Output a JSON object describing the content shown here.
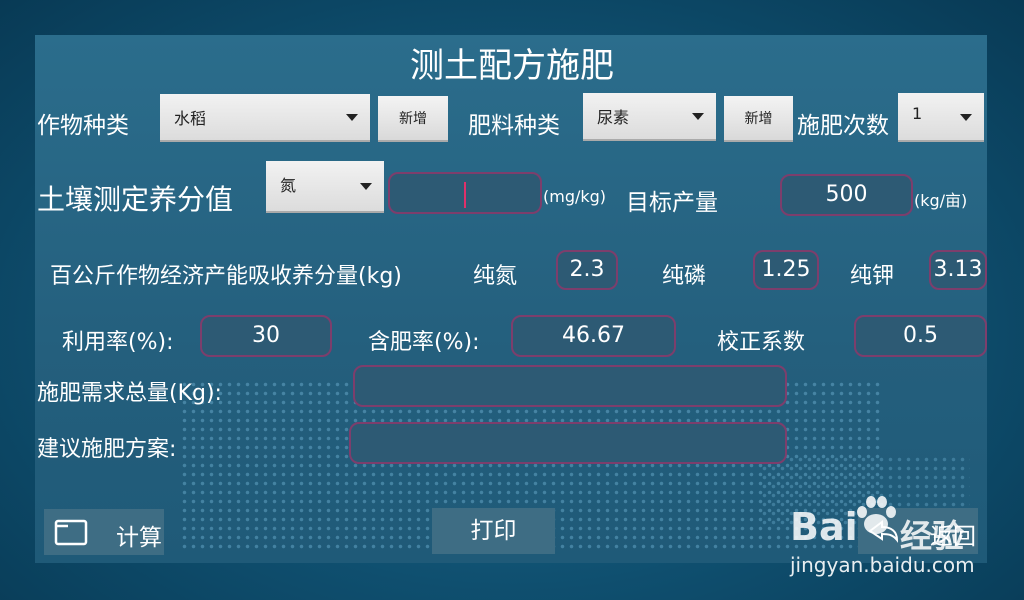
{
  "title": "测土配方施肥",
  "row1": {
    "crop_label": "作物种类",
    "crop_value": "水稻",
    "add1": "新增",
    "fert_label": "肥料种类",
    "fert_value": "尿素",
    "add2": "新增",
    "times_label": "施肥次数",
    "times_value": "1"
  },
  "row2": {
    "soil_label": "土壤测定养分值",
    "nutrient_value": "氮",
    "soil_input": "",
    "soil_unit": "(mg/kg)",
    "target_label": "目标产量",
    "target_value": "500",
    "target_unit": "(kg/亩)"
  },
  "row3": {
    "absorb_label": "百公斤作物经济产能吸收养分量(kg)",
    "n_label": "纯氮",
    "n_value": "2.3",
    "p_label": "纯磷",
    "p_value": "1.25",
    "k_label": "纯钾",
    "k_value": "3.13"
  },
  "row4": {
    "util_label": "利用率(%):",
    "util_value": "30",
    "content_label": "含肥率(%):",
    "content_value": "46.67",
    "coef_label": "校正系数",
    "coef_value": "0.5"
  },
  "row5": {
    "total_label": "施肥需求总量(Kg):",
    "total_value": ""
  },
  "row6": {
    "plan_label": "建议施肥方案:",
    "plan_value": ""
  },
  "bottom": {
    "calc_label": "计算",
    "print_label": "打印",
    "back_label": "返回"
  },
  "watermark": {
    "brand": "Bai",
    "brand2": "经验",
    "url": "jingyan.baidu.com"
  }
}
